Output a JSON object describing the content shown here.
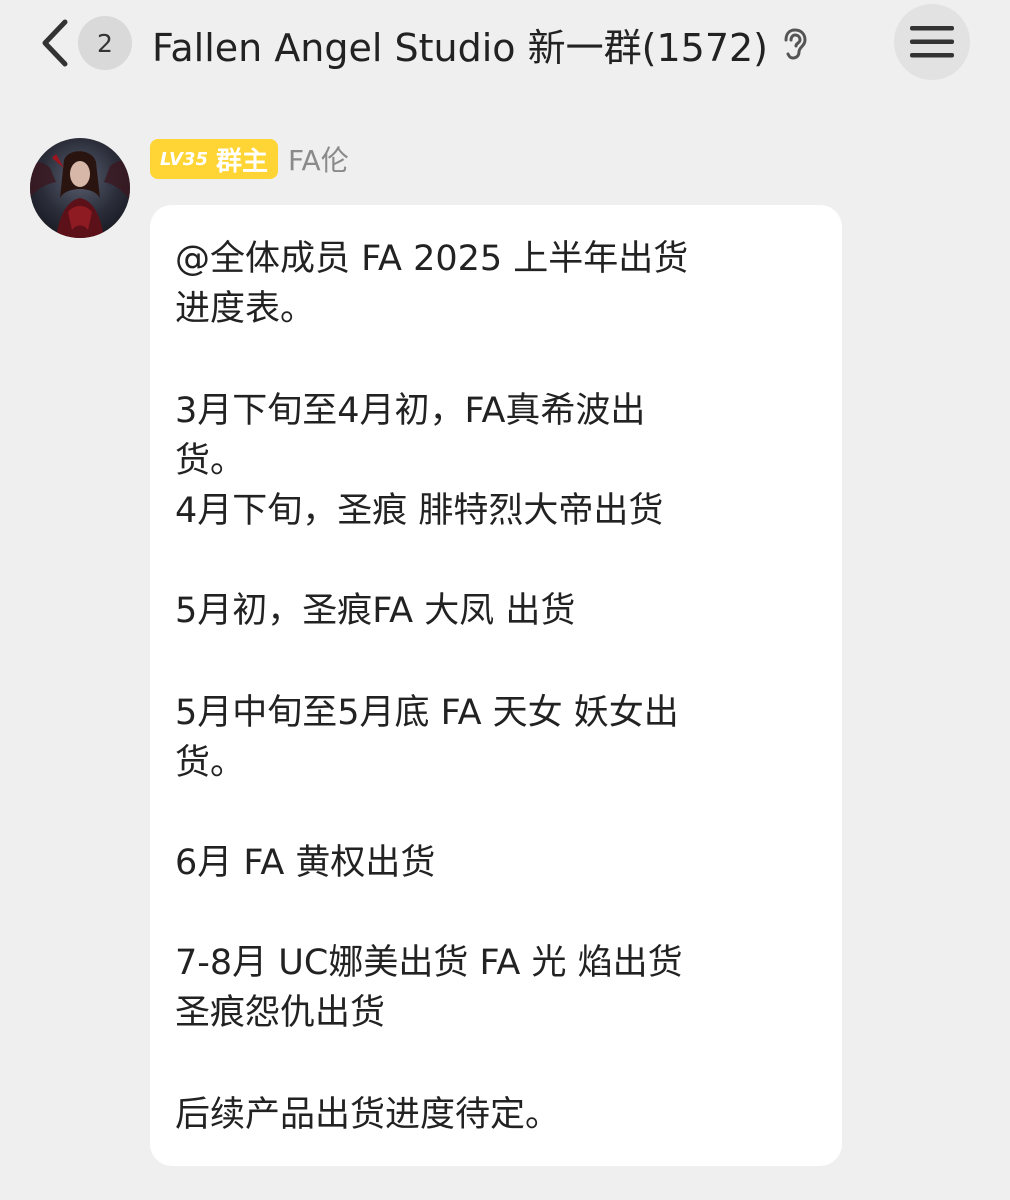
{
  "header": {
    "back_icon": "chevron-left-icon",
    "unread_count": "2",
    "title": "Fallen Angel Studio 新一群(1572)",
    "ear_icon": "ear-icon",
    "menu_icon": "hamburger-menu-icon"
  },
  "message": {
    "sender": {
      "level": "LV35",
      "role": "群主",
      "name": "FA伦"
    },
    "lines": [
      "@全体成员 FA 2025 上半年出货",
      "进度表。",
      "3月下旬至4月初，FA真希波出",
      "货。",
      "4月下旬，圣痕 腓特烈大帝出货",
      "5月初，圣痕FA 大凤 出货",
      "5月中旬至5月底 FA 天女 妖女出",
      "货。",
      "6月 FA 黄权出货",
      "7-8月 UC娜美出货 FA 光 焰出货",
      "圣痕怨仇出货",
      "后续产品出货进度待定。"
    ]
  },
  "colors": {
    "background": "#efefef",
    "bubble": "#ffffff",
    "level_badge": "#ffd535",
    "name_text": "#8a8a8a"
  }
}
